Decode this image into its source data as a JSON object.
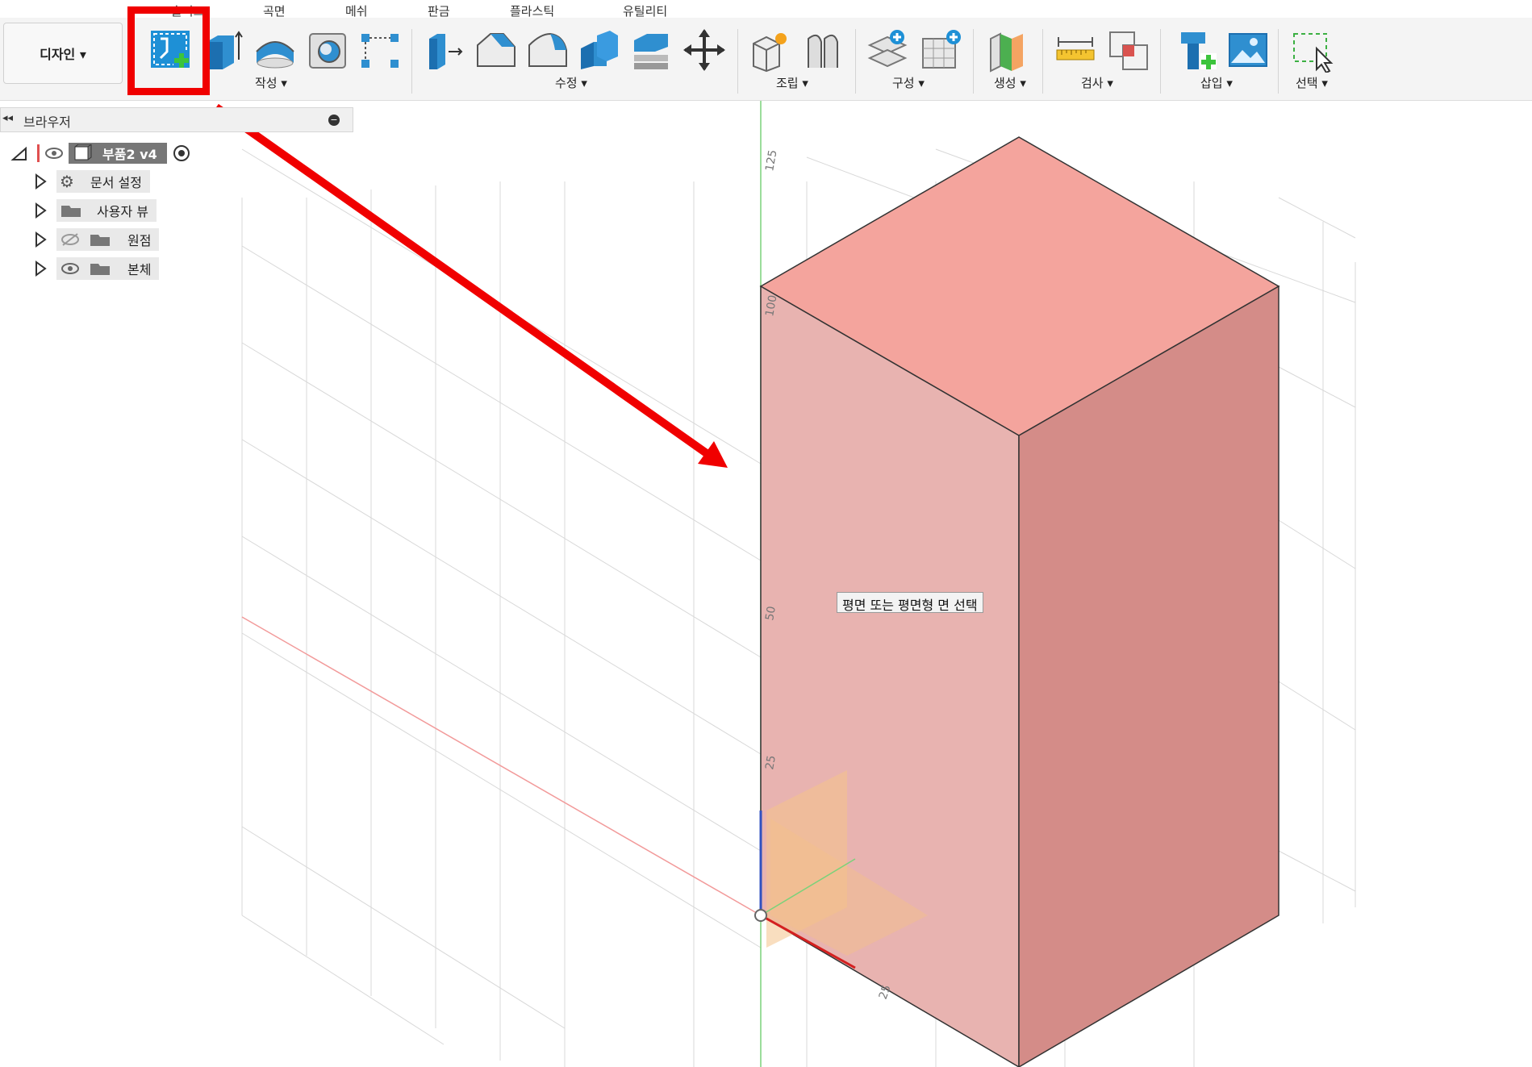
{
  "tabs": [
    "솔리드",
    "곡면",
    "메쉬",
    "판금",
    "플라스틱",
    "유틸리티"
  ],
  "workspace": {
    "label": "디자인 ▾"
  },
  "toolbar_groups": {
    "create": "작성 ▾",
    "modify": "수정 ▾",
    "assemble": "조립 ▾",
    "construct": "구성 ▾",
    "fabricate": "생성 ▾",
    "inspect": "검사 ▾",
    "insert": "삽입 ▾",
    "select": "선택 ▾"
  },
  "browser": {
    "title": "브라우저",
    "root": {
      "label": "부품2 v4"
    },
    "items": [
      {
        "label": "문서 설정",
        "icon": "gear-icon"
      },
      {
        "label": "사용자 뷰",
        "icon": "folder-icon"
      },
      {
        "label": "원점",
        "icon": "folder-icon",
        "hidden": true
      },
      {
        "label": "본체",
        "icon": "folder-icon"
      }
    ]
  },
  "viewport": {
    "tooltip": "평면 또는 평면형 면 선택",
    "axis_labels": [
      "125",
      "100",
      "50",
      "25",
      "25"
    ]
  },
  "colors": {
    "accent_blue": "#1e90d6",
    "annotation_red": "#f00000",
    "body_face_front": "#e8b3b0",
    "body_face_top": "#f4a49d",
    "body_face_side": "#d48c88"
  }
}
